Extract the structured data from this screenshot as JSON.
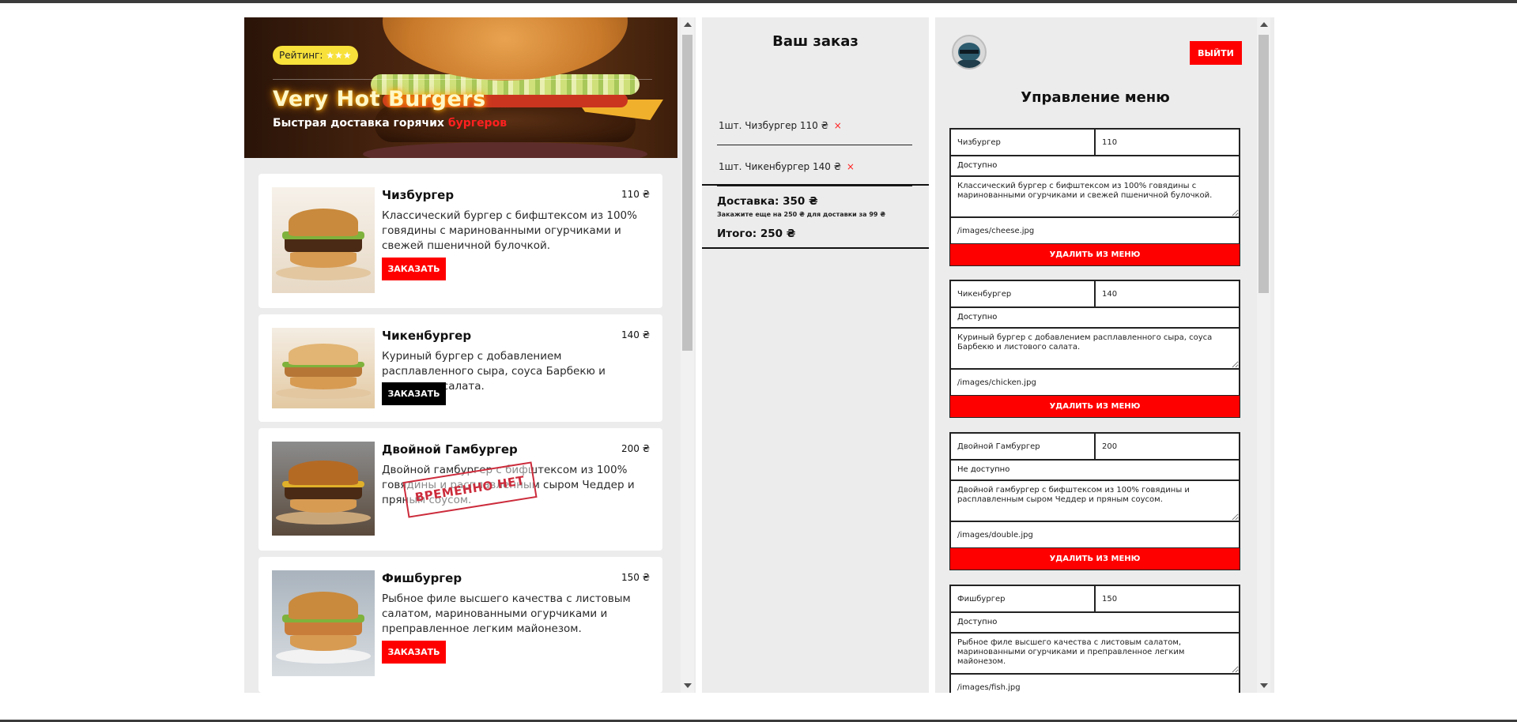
{
  "header": {
    "rating_label": "Рейтинг:",
    "rating_stars": "★★★",
    "brand": "Very Hot Burgers",
    "tagline_text": "Быстрая доставка горячих",
    "tagline_accent": "бургеров"
  },
  "menu": {
    "items": [
      {
        "name": "Чизбургер",
        "price": "110 ₴",
        "description": "Классический бургер с бифштексом из 100% говядины с маринованными огурчиками и свежей пшеничной булочкой.",
        "button": "ЗАКАЗАТЬ"
      },
      {
        "name": "Чикенбургер",
        "price": "140 ₴",
        "description": "Куриный бургер с добавлением расплавленного сыра, соуса Барбекю и листового салата.",
        "button": "ЗАКАЗАТЬ"
      },
      {
        "name": "Двойной Гамбургер",
        "price": "200 ₴",
        "description": "Двойной гамбургер с бифштексом из 100% говядины и расплавленным сыром Чеддер и пряным соусом.",
        "stamp": "ВРЕМЕННО НЕТ"
      },
      {
        "name": "Фишбургер",
        "price": "150 ₴",
        "description": "Рыбное филе высшего качества с листовым салатом, маринованными огурчиками и преправленное легким майонезом.",
        "button": "ЗАКАЗАТЬ"
      }
    ]
  },
  "order": {
    "title": "Ваш заказ",
    "items": [
      {
        "text": "1шт. Чизбургер 110 ₴",
        "remove": "×"
      },
      {
        "text": "1шт. Чикенбургер 140 ₴",
        "remove": "×"
      }
    ],
    "delivery": "Доставка: 350 ₴",
    "delivery_note": "Закажите еще на 250 ₴ для доставки за 99 ₴",
    "total": "Итого: 250 ₴"
  },
  "admin": {
    "title": "Управление меню",
    "logout": "ВЫЙТИ",
    "delete_label": "УДАЛИТЬ ИЗ МЕНЮ",
    "forms": [
      {
        "name": "Чизбургер",
        "price": "110",
        "status": "Доступно",
        "description": "Классический бургер с бифштексом из 100% говядины с маринованными огурчиками и свежей пшеничной булочкой.",
        "image": "/images/cheese.jpg"
      },
      {
        "name": "Чикенбургер",
        "price": "140",
        "status": "Доступно",
        "description": "Куриный бургер с добавлением расплавленного сыра, соуса Барбекю и листового салата.",
        "image": "/images/chicken.jpg"
      },
      {
        "name": "Двойной Гамбургер",
        "price": "200",
        "status": "Не доступно",
        "description": "Двойной гамбургер с бифштексом из 100% говядины и расплавленным сыром Чеддер и пряным соусом.",
        "image": "/images/double.jpg"
      },
      {
        "name": "Фишбургер",
        "price": "150",
        "status": "Доступно",
        "description": "Рыбное филе высшего качества с листовым салатом, маринованными огурчиками и преправленное легким майонезом.",
        "image": "/images/fish.jpg"
      }
    ]
  },
  "colors": {
    "accent": "#ff0000",
    "panel_bg": "#ececec",
    "rating_badge": "#f7e13a"
  }
}
